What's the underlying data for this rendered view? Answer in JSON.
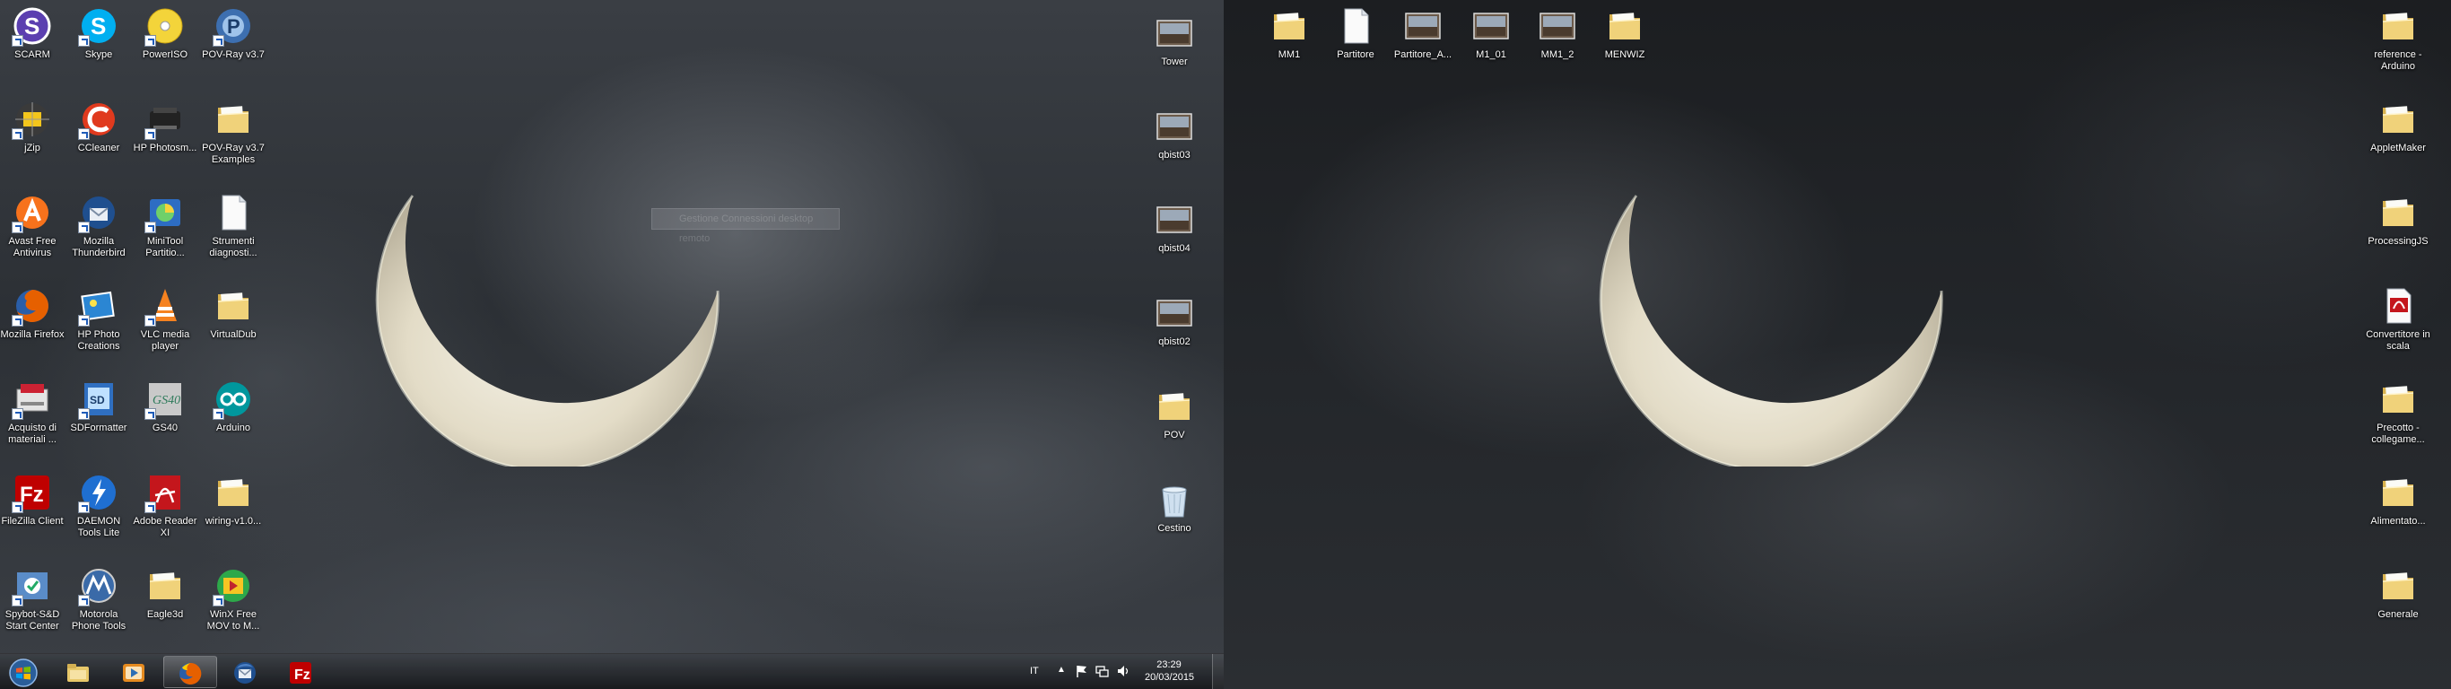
{
  "left_desktop": {
    "icons": [
      {
        "label": "SCARM",
        "icon": "scarm-icon"
      },
      {
        "label": "Skype",
        "icon": "skype-icon"
      },
      {
        "label": "PowerISO",
        "icon": "poweriso-icon"
      },
      {
        "label": "POV-Ray v3.7",
        "icon": "povray-icon"
      },
      {
        "label": "jZip",
        "icon": "jzip-icon"
      },
      {
        "label": "CCleaner",
        "icon": "ccleaner-icon"
      },
      {
        "label": "HP Photosm...",
        "icon": "hp-photosmart-icon"
      },
      {
        "label": "POV-Ray v3.7 Examples",
        "icon": "folder-icon"
      },
      {
        "label": "Avast Free Antivirus",
        "icon": "avast-icon"
      },
      {
        "label": "Mozilla Thunderbird",
        "icon": "thunderbird-icon"
      },
      {
        "label": "MiniTool Partitio...",
        "icon": "minitool-icon"
      },
      {
        "label": "Strumenti diagnosti...",
        "icon": "document-icon"
      },
      {
        "label": "Mozilla Firefox",
        "icon": "firefox-icon"
      },
      {
        "label": "HP Photo Creations",
        "icon": "hp-photo-creations-icon"
      },
      {
        "label": "VLC media player",
        "icon": "vlc-icon"
      },
      {
        "label": "VirtualDub",
        "icon": "folder-icon"
      },
      {
        "label": "Acquisto di materiali ...",
        "icon": "acquisto-icon"
      },
      {
        "label": "SDFormatter",
        "icon": "sdformatter-icon"
      },
      {
        "label": "GS40",
        "icon": "gs40-icon"
      },
      {
        "label": "Arduino",
        "icon": "arduino-icon"
      },
      {
        "label": "FileZilla Client",
        "icon": "filezilla-icon"
      },
      {
        "label": "DAEMON Tools Lite",
        "icon": "daemon-tools-icon"
      },
      {
        "label": "Adobe Reader XI",
        "icon": "adobe-reader-icon"
      },
      {
        "label": "wiring-v1.0...",
        "icon": "folder-icon"
      },
      {
        "label": "Spybot-S&D Start Center",
        "icon": "spybot-icon"
      },
      {
        "label": "Motorola Phone Tools",
        "icon": "motorola-icon"
      },
      {
        "label": "Eagle3d",
        "icon": "folder-icon"
      },
      {
        "label": "WinX Free MOV to M...",
        "icon": "winx-icon"
      }
    ],
    "right_column": [
      {
        "label": "Tower",
        "icon": "image-thumbnail-icon"
      },
      {
        "label": "qbist03",
        "icon": "image-thumbnail-icon"
      },
      {
        "label": "qbist04",
        "icon": "image-thumbnail-icon"
      },
      {
        "label": "qbist02",
        "icon": "image-thumbnail-icon"
      },
      {
        "label": "POV",
        "icon": "folder-icon"
      },
      {
        "label": "Cestino",
        "icon": "recycle-bin-icon"
      }
    ]
  },
  "right_desktop": {
    "top_row": [
      {
        "label": "MM1",
        "icon": "folder-icon"
      },
      {
        "label": "Partitore",
        "icon": "document-icon"
      },
      {
        "label": "Partitore_A...",
        "icon": "image-thumbnail-icon"
      },
      {
        "label": "M1_01",
        "icon": "image-thumbnail-icon"
      },
      {
        "label": "MM1_2",
        "icon": "image-thumbnail-icon"
      },
      {
        "label": "MENWIZ",
        "icon": "folder-icon"
      }
    ],
    "right_column": [
      {
        "label": "reference - Arduino",
        "icon": "folder-icon"
      },
      {
        "label": "AppletMaker",
        "icon": "folder-icon"
      },
      {
        "label": "ProcessingJS",
        "icon": "folder-icon"
      },
      {
        "label": "Convertitore in scala",
        "icon": "pdf-icon"
      },
      {
        "label": "Precotto - collegame...",
        "icon": "folder-icon"
      },
      {
        "label": "Alimentato...",
        "icon": "folder-icon"
      },
      {
        "label": "Generale",
        "icon": "folder-icon"
      }
    ]
  },
  "ghost_window_title": "Gestione Connessioni desktop remoto",
  "taskbar": {
    "pinned": [
      {
        "name": "start-orb-icon"
      },
      {
        "name": "windows-explorer-icon"
      },
      {
        "name": "media-player-icon"
      },
      {
        "name": "firefox-icon"
      },
      {
        "name": "thunderbird-icon"
      },
      {
        "name": "filezilla-icon"
      }
    ],
    "language": "IT",
    "time": "23:29",
    "date": "20/03/2015"
  },
  "colors": {
    "folder": "#e8c86a",
    "taskbar": "#1a1c1f",
    "moon": "#e6e0cc"
  }
}
